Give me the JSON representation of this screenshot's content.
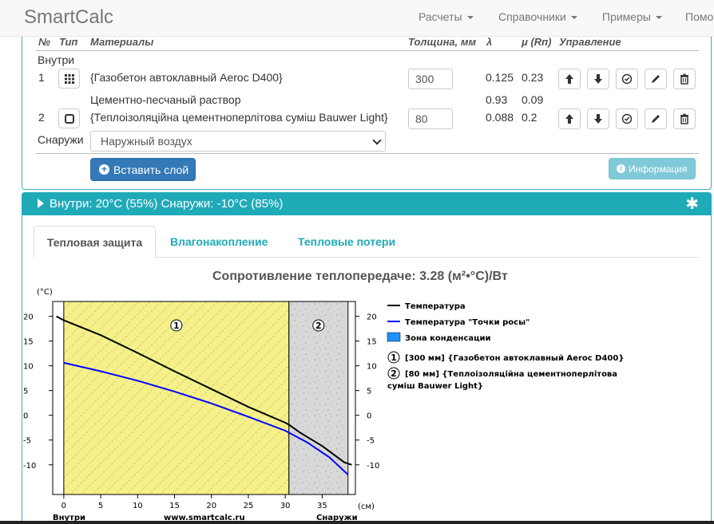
{
  "navbar": {
    "brand": "SmartCalc",
    "items": [
      {
        "label": "Расчеты"
      },
      {
        "label": "Справочники"
      },
      {
        "label": "Примеры"
      },
      {
        "label": "Помо"
      }
    ]
  },
  "layers": {
    "headers": {
      "num": "№",
      "type": "Тип",
      "materials": "Материалы",
      "thickness": "Толщина, мм",
      "lambda": "λ",
      "mu": "μ (Rп)",
      "controls": "Управление"
    },
    "inside_label": "Внутри",
    "outside_label": "Снаружи",
    "rows": [
      {
        "num": "1",
        "material": "{Газобетон автоклавный Aeroc D400}",
        "thickness": "300",
        "lambda": "0.125",
        "mu": "0.23"
      },
      {
        "num": "",
        "material": "Цементно-песчаный раствор",
        "thickness": "",
        "lambda": "0.93",
        "mu": "0.09"
      },
      {
        "num": "2",
        "material": "{Теплоізоляційна цементноперлітова суміш Bauwer Light}",
        "thickness": "80",
        "lambda": "0.088",
        "mu": "0.2"
      }
    ],
    "outside_select": "Наружный воздух",
    "insert_button": "Вставить слой",
    "info_button": "Информация"
  },
  "conditions": {
    "text": "Внутри: 20°C (55%) Снаружи: -10°C (85%)"
  },
  "tabs": [
    {
      "label": "Тепловая защита",
      "active": true
    },
    {
      "label": "Влагонакопление"
    },
    {
      "label": "Тепловые потери"
    }
  ],
  "chart_data": {
    "type": "line",
    "title": "Сопротивление теплопередаче: 3.28 (м²•°С)/Вт",
    "ylabel": "(°С)",
    "xlabel": "(см)",
    "xlim": [
      -1.5,
      39.5
    ],
    "ylim": [
      -16,
      23
    ],
    "x_ticks": [
      0,
      5,
      10,
      15,
      20,
      25,
      30,
      35
    ],
    "y_ticks": [
      -10,
      -5,
      0,
      5,
      10,
      15,
      20
    ],
    "bottom_labels": {
      "left": "Внутри",
      "center": "www.smartcalc.ru",
      "right": "Снаружи"
    },
    "layers": [
      {
        "id": "1",
        "from": 0,
        "to": 30.5,
        "fill": "#f5f08a",
        "pattern": "hatch"
      },
      {
        "id": "2",
        "from": 30.5,
        "to": 38.5,
        "fill": "#d8d8d8",
        "pattern": "speckle"
      }
    ],
    "series": [
      {
        "name": "Температура",
        "color": "#000000",
        "x": [
          -1,
          0,
          5,
          10,
          15,
          20,
          25,
          30,
          30.5,
          32,
          35,
          38,
          39
        ],
        "y": [
          20,
          19.2,
          16.2,
          12.6,
          8.9,
          5.3,
          1.7,
          -1.5,
          -1.9,
          -3.5,
          -6.2,
          -9.5,
          -10
        ]
      },
      {
        "name": "Температура \"Точки росы\"",
        "color": "#0000ff",
        "x": [
          0,
          5,
          10,
          15,
          20,
          25,
          30,
          33,
          36,
          38.5
        ],
        "y": [
          10.6,
          8.9,
          7.0,
          4.8,
          2.4,
          -0.3,
          -3.1,
          -5.5,
          -8.5,
          -12
        ]
      }
    ],
    "legend": {
      "placement": "right",
      "series": [
        "Температура",
        "Температура \"Точки росы\""
      ],
      "zone": "Зона конденсации",
      "zone_color": "#1e90ff",
      "layer_notes": [
        {
          "num": "1",
          "text": "[300 мм] {Газобетон автоклавный Aeroc D400}"
        },
        {
          "num": "2",
          "text_line1": "[80 мм] {Теплоізоляційна цементноперлітова",
          "text_line2": "суміш Bauwer Light}"
        }
      ]
    }
  }
}
